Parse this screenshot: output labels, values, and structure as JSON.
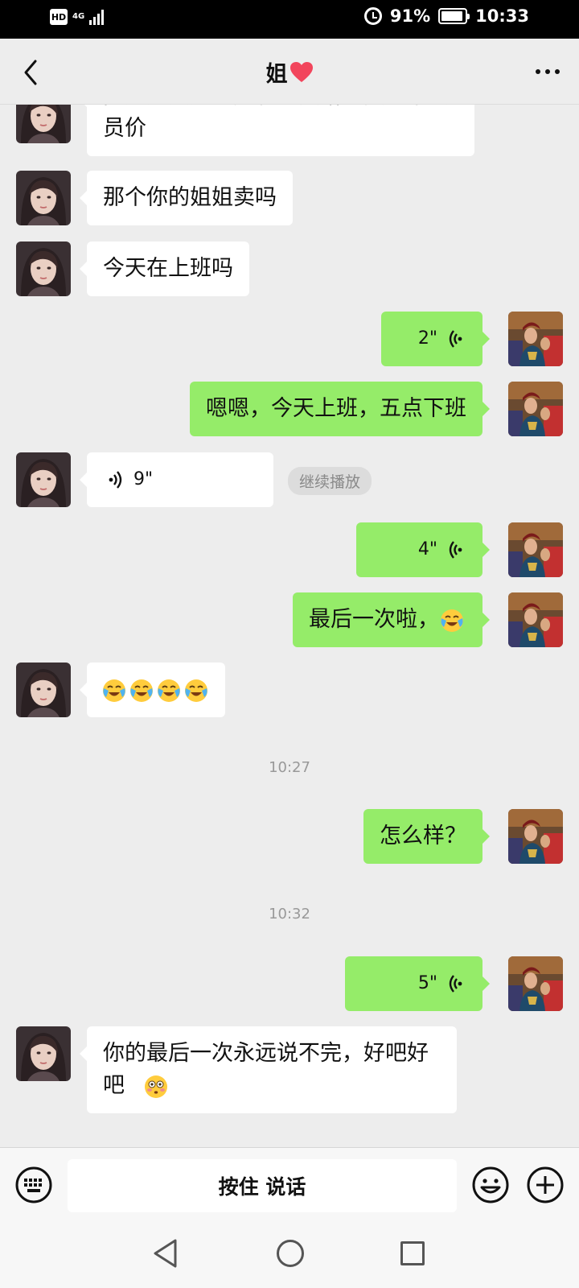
{
  "status_bar": {
    "hd": "HD",
    "network": "4G",
    "battery_percent": "91%",
    "battery_level": 0.91,
    "time": "10:33"
  },
  "header": {
    "title": "姐",
    "title_icon": "heart-icon",
    "back_icon": "chevron-left-icon",
    "more_icon": "more-dots-icon"
  },
  "messages": [
    {
      "side": "left",
      "type": "text",
      "text": "问题是大姐我还有进货给钱卖的话会员价"
    },
    {
      "side": "left",
      "type": "text",
      "text": "那个你的姐姐卖吗"
    },
    {
      "side": "left",
      "type": "text",
      "text": "今天在上班吗"
    },
    {
      "side": "right",
      "type": "voice",
      "duration": "2\""
    },
    {
      "side": "right",
      "type": "text",
      "text": "嗯嗯，今天上班，五点下班"
    },
    {
      "side": "left",
      "type": "voice",
      "duration": "9\"",
      "action": "继续播放"
    },
    {
      "side": "right",
      "type": "voice",
      "duration": "4\""
    },
    {
      "side": "right",
      "type": "text",
      "text": "最后一次啦，",
      "emoji": "crying-laughing-emoji"
    },
    {
      "side": "left",
      "type": "emoji",
      "emoji": "crying-laughing-emoji",
      "count": 4
    },
    {
      "type": "time",
      "text": "10:27"
    },
    {
      "side": "right",
      "type": "text",
      "text": "怎么样？"
    },
    {
      "type": "time",
      "text": "10:32"
    },
    {
      "side": "right",
      "type": "voice",
      "duration": "5\""
    },
    {
      "side": "left",
      "type": "text",
      "text": "你的最后一次永远说不完，好吧好吧",
      "emoji": "flushed-emoji"
    }
  ],
  "input_bar": {
    "hold_to_talk": "按住 说话",
    "keyboard_icon": "keyboard-icon",
    "emoji_icon": "smiley-icon",
    "plus_icon": "plus-icon"
  },
  "system_nav": {
    "back": "nav-back-icon",
    "home": "nav-home-icon",
    "recent": "nav-recent-icon"
  },
  "colors": {
    "sent_bubble": "#95ec69",
    "received_bubble": "#ffffff",
    "chat_bg": "#ededed",
    "heart": "#f2455c"
  }
}
